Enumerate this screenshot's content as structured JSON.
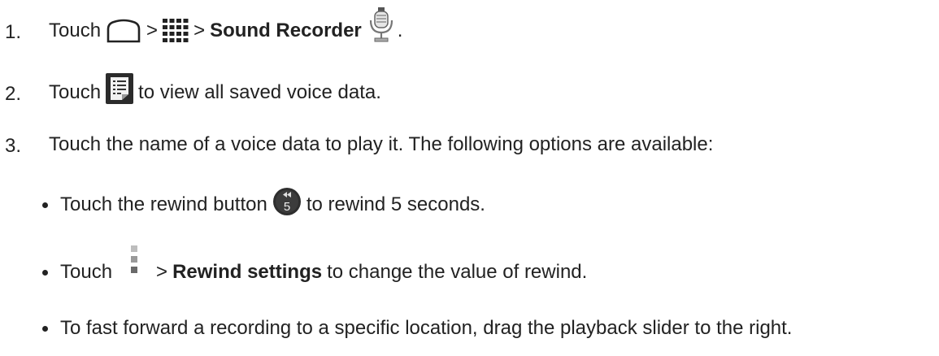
{
  "steps": [
    {
      "num": "1.",
      "text_a": "Touch",
      "sep1": ">",
      "sep2": ">",
      "bold": "Sound Recorder",
      "end": "."
    },
    {
      "num": "2.",
      "text_a": "Touch",
      "text_b": "to view all saved voice data."
    },
    {
      "num": "3.",
      "text": "Touch the name of a voice data to play it. The following options are available:"
    }
  ],
  "bullets": [
    {
      "text_a": "Touch the rewind button",
      "text_b": "to rewind 5 seconds.",
      "icon_label": "5"
    },
    {
      "text_a": "Touch",
      "sep": ">",
      "bold": "Rewind settings",
      "text_b": "to change the value of rewind."
    },
    {
      "text": "To fast forward a recording to a specific location, drag the playback slider to the right."
    }
  ],
  "icons": [
    "home-icon",
    "apps-grid-icon",
    "microphone-icon",
    "list-icon",
    "rewind-5-icon",
    "menu-dots-icon"
  ]
}
